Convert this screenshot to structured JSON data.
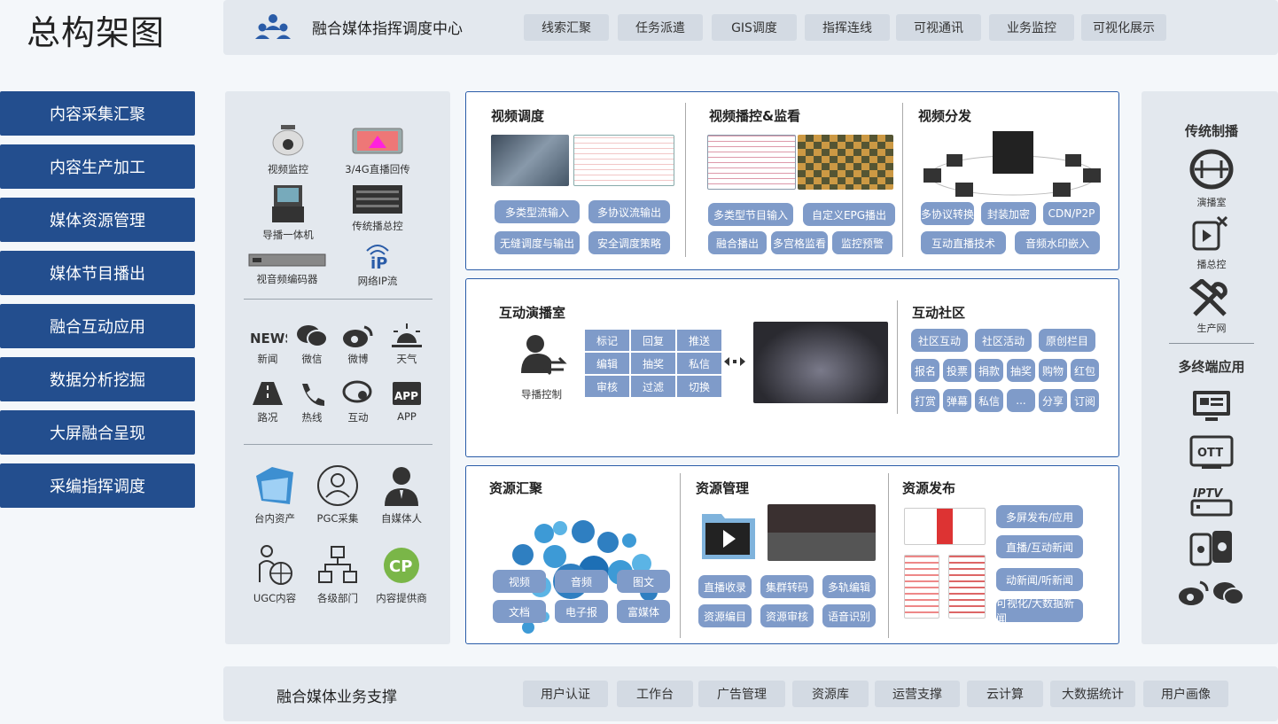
{
  "page_title": "总构架图",
  "top": {
    "center_label": "融合媒体指挥调度中心",
    "chips": [
      "线索汇聚",
      "任务派遣",
      "GIS调度",
      "指挥连线",
      "可视通讯",
      "业务监控",
      "可视化展示"
    ]
  },
  "left_nav": [
    "内容采集汇聚",
    "内容生产加工",
    "媒体资源管理",
    "媒体节目播出",
    "融合互动应用",
    "数据分析挖掘",
    "大屏融合呈现",
    "采编指挥调度"
  ],
  "sources": {
    "group1": [
      "视频监控",
      "3/4G直播回传",
      "导播一体机",
      "传统播总控",
      "视音频编码器",
      "网络IP流"
    ],
    "group2": [
      "新闻",
      "微信",
      "微博",
      "天气",
      "路况",
      "热线",
      "互动",
      "APP"
    ],
    "group2_glyph_text": {
      "news": "NEWS",
      "app": "APP"
    },
    "group3": [
      "台内资产",
      "PGC采集",
      "自媒体人",
      "UGC内容",
      "各级部门",
      "内容提供商"
    ],
    "group3_glyph_text": {
      "cp": "CP"
    },
    "network_ip_glyph": "iP"
  },
  "video_box": {
    "s1": {
      "title": "视频调度",
      "tags": [
        "多类型流输入",
        "多协议流输出",
        "无缝调度与输出",
        "安全调度策略"
      ]
    },
    "s2": {
      "title": "视频播控&监看",
      "tags": [
        "多类型节目输入",
        "自定义EPG播出",
        "融合播出",
        "多宫格监看",
        "监控预警"
      ]
    },
    "s3": {
      "title": "视频分发",
      "tags": [
        "多协议转换",
        "封装加密",
        "CDN/P2P",
        "互动直播技术",
        "音频水印嵌入"
      ]
    }
  },
  "interact_box": {
    "s1": {
      "title": "互动演播室",
      "icon_label": "导播控制",
      "grid": [
        "标记",
        "回复",
        "推送",
        "编辑",
        "抽奖",
        "私信",
        "审核",
        "过滤",
        "切换"
      ]
    },
    "s2": {
      "title": "互动社区",
      "row1": [
        "社区互动",
        "社区活动",
        "原创栏目"
      ],
      "row2": [
        "报名",
        "投票",
        "捐款",
        "抽奖",
        "购物",
        "红包"
      ],
      "row3": [
        "打赏",
        "弹幕",
        "私信",
        "...",
        "分享",
        "订阅"
      ]
    }
  },
  "resource_box": {
    "s1": {
      "title": "资源汇聚",
      "tags": [
        "视频",
        "音频",
        "图文",
        "文档",
        "电子报",
        "富媒体"
      ]
    },
    "s2": {
      "title": "资源管理",
      "tags": [
        "直播收录",
        "集群转码",
        "多轨编辑",
        "资源编目",
        "资源审核",
        "语音识别"
      ]
    },
    "s3": {
      "title": "资源发布",
      "tags": [
        "多屏发布/应用",
        "直播/互动新闻",
        "动新闻/听新闻",
        "可视化/大数据新闻"
      ]
    }
  },
  "right": {
    "title1": "传统制播",
    "items1": [
      "演播室",
      "播总控",
      "生产网"
    ],
    "title2": "多终端应用",
    "ott_glyph": "OTT",
    "iptv_glyph": "IPTV"
  },
  "bottom": {
    "label": "融合媒体业务支撑",
    "chips": [
      "用户认证",
      "工作台",
      "广告管理",
      "资源库",
      "运营支撑",
      "云计算",
      "大数据统计",
      "用户画像"
    ]
  },
  "colors": {
    "nav": "#234e8e",
    "tag": "#7f9bc9",
    "border": "#2a5ca8",
    "panel": "#e3e8ee"
  }
}
